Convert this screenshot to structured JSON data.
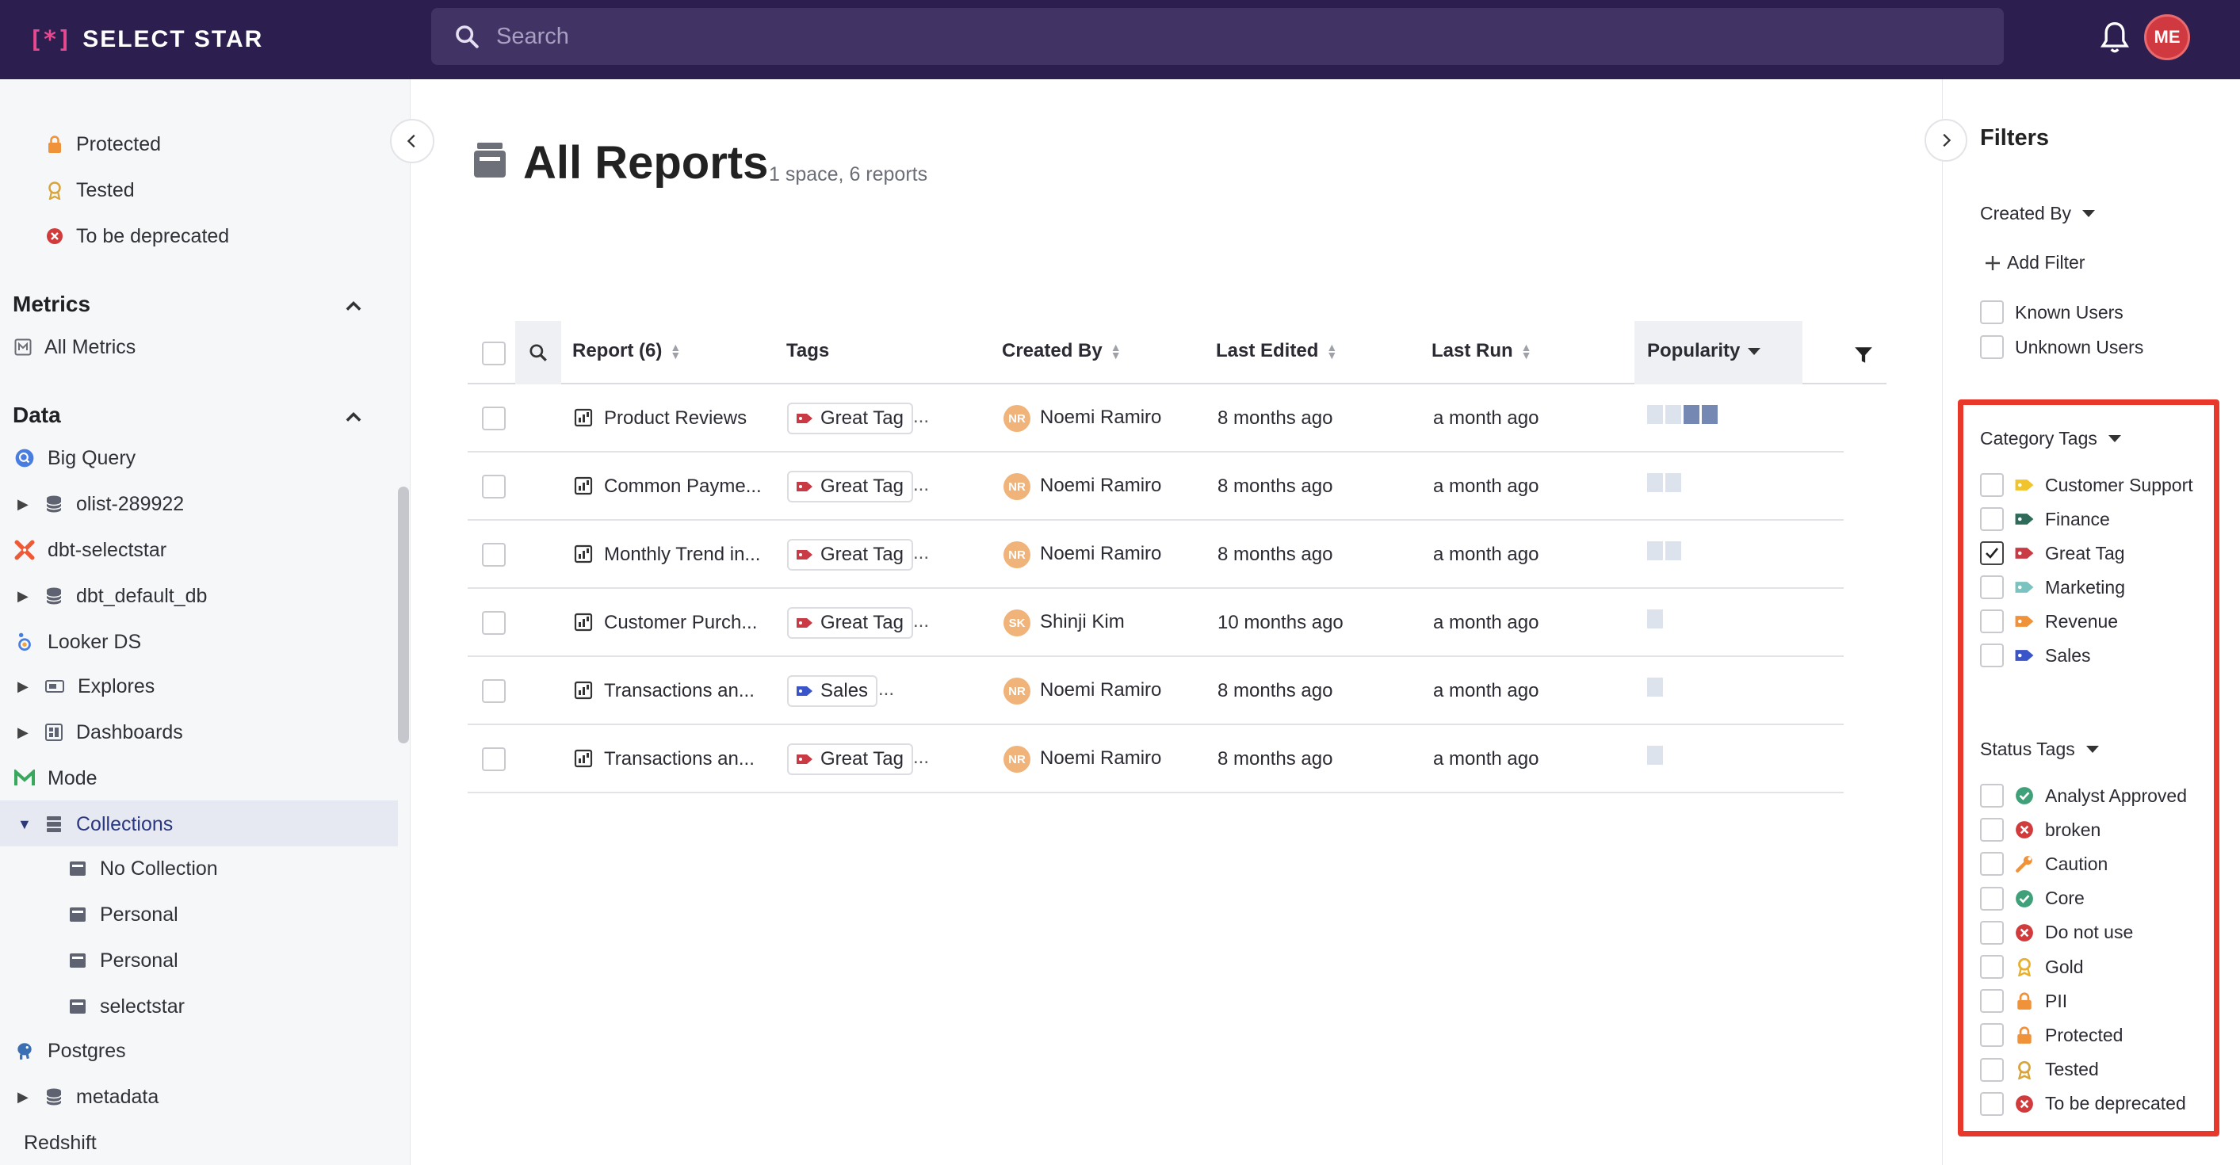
{
  "topbar": {
    "logo_mark": "[*]",
    "logo_text": "SELECT STAR",
    "search_placeholder": "Search",
    "avatar_initials": "ME"
  },
  "sidebar": {
    "status_items": [
      {
        "label": "Protected",
        "icon": "lock-icon"
      },
      {
        "label": "Tested",
        "icon": "ribbon-icon"
      },
      {
        "label": "To be deprecated",
        "icon": "x-circle-icon"
      }
    ],
    "metrics_header": "Metrics",
    "metrics_items": [
      {
        "label": "All Metrics",
        "icon": "metric-icon"
      }
    ],
    "data_header": "Data",
    "data_items": [
      {
        "label": "Big Query"
      },
      {
        "label": "olist-289922"
      },
      {
        "label": "dbt-selectstar"
      },
      {
        "label": "dbt_default_db"
      },
      {
        "label": "Looker DS"
      },
      {
        "label": "Explores"
      },
      {
        "label": "Dashboards"
      },
      {
        "label": "Mode"
      },
      {
        "label": "Collections"
      },
      {
        "label": "No Collection"
      },
      {
        "label": "Personal"
      },
      {
        "label": "Personal"
      },
      {
        "label": "selectstar"
      },
      {
        "label": "Postgres"
      },
      {
        "label": "metadata"
      },
      {
        "label": "Redshift"
      }
    ]
  },
  "main": {
    "title": "All Reports",
    "subtitle": "1 space, 6 reports",
    "columns": {
      "report": "Report (6)",
      "tags": "Tags",
      "created_by": "Created By",
      "last_edited": "Last Edited",
      "last_run": "Last Run",
      "popularity": "Popularity"
    },
    "rows": [
      {
        "name": "Product Reviews",
        "tag": "Great Tag",
        "tag_color": "#c93a45",
        "more": "...",
        "initials": "NR",
        "creator": "Noemi Ramiro",
        "edited": "8 months ago",
        "run": "a month ago",
        "popularity": 4
      },
      {
        "name": "Common Payme...",
        "tag": "Great Tag",
        "tag_color": "#c93a45",
        "more": "...",
        "initials": "NR",
        "creator": "Noemi Ramiro",
        "edited": "8 months ago",
        "run": "a month ago",
        "popularity": 2
      },
      {
        "name": "Monthly Trend in...",
        "tag": "Great Tag",
        "tag_color": "#c93a45",
        "more": "...",
        "initials": "NR",
        "creator": "Noemi Ramiro",
        "edited": "8 months ago",
        "run": "a month ago",
        "popularity": 2
      },
      {
        "name": "Customer Purch...",
        "tag": "Great Tag",
        "tag_color": "#c93a45",
        "more": "...",
        "initials": "SK",
        "creator": "Shinji Kim",
        "edited": "10 months ago",
        "run": "a month ago",
        "popularity": 1
      },
      {
        "name": "Transactions an...",
        "tag": "Sales",
        "tag_color": "#3a55c9",
        "more": "...",
        "initials": "NR",
        "creator": "Noemi Ramiro",
        "edited": "8 months ago",
        "run": "a month ago",
        "popularity": 1
      },
      {
        "name": "Transactions an...",
        "tag": "Great Tag",
        "tag_color": "#c93a45",
        "more": "...",
        "initials": "NR",
        "creator": "Noemi Ramiro",
        "edited": "8 months ago",
        "run": "a month ago",
        "popularity": 1
      }
    ]
  },
  "filters": {
    "title": "Filters",
    "created_by_label": "Created By",
    "add_filter": "Add Filter",
    "created_by_options": [
      "Known Users",
      "Unknown Users"
    ],
    "category_label": "Category Tags",
    "category_options": [
      {
        "label": "Customer Support",
        "color": "#f2c42c",
        "checked": false
      },
      {
        "label": "Finance",
        "color": "#2f6b5a",
        "checked": false
      },
      {
        "label": "Great Tag",
        "color": "#c93a45",
        "checked": true
      },
      {
        "label": "Marketing",
        "color": "#7ac3c0",
        "checked": false
      },
      {
        "label": "Revenue",
        "color": "#f0923a",
        "checked": false
      },
      {
        "label": "Sales",
        "color": "#3a55c9",
        "checked": false
      }
    ],
    "status_label": "Status Tags",
    "status_options": [
      {
        "label": "Analyst Approved",
        "icon": "check-circle-icon",
        "color": "#3fa07a"
      },
      {
        "label": "broken",
        "icon": "x-circle-icon",
        "color": "#d23b3b"
      },
      {
        "label": "Caution",
        "icon": "wrench-icon",
        "color": "#f0923a"
      },
      {
        "label": "Core",
        "icon": "check-circle-icon",
        "color": "#3fa07a"
      },
      {
        "label": "Do not use",
        "icon": "x-circle-icon",
        "color": "#d23b3b"
      },
      {
        "label": "Gold",
        "icon": "ribbon-icon",
        "color": "#e8b02a"
      },
      {
        "label": "PII",
        "icon": "lock-icon",
        "color": "#f0923a"
      },
      {
        "label": "Protected",
        "icon": "lock-icon",
        "color": "#f0923a"
      },
      {
        "label": "Tested",
        "icon": "ribbon-icon",
        "color": "#d9a43a"
      },
      {
        "label": "To be deprecated",
        "icon": "x-circle-icon",
        "color": "#d23b3b"
      }
    ]
  }
}
